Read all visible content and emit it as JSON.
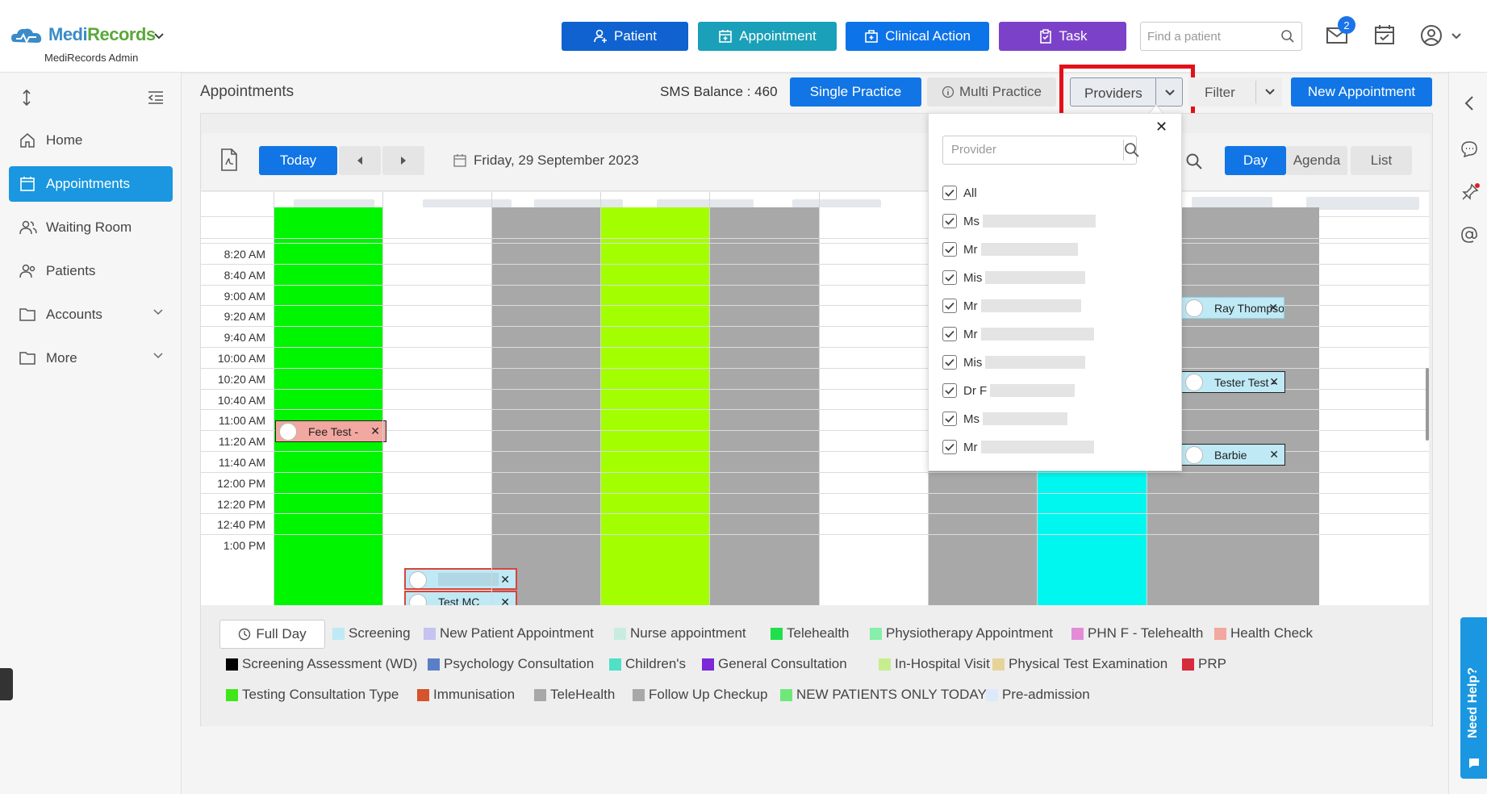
{
  "header": {
    "logo_main": "Medi",
    "logo_accent": "Records",
    "org_label": "MediRecords Admin",
    "buttons": [
      {
        "label": "Patient",
        "color": "#0f62cf"
      },
      {
        "label": "Appointment",
        "color": "#1aa0b8"
      },
      {
        "label": "Clinical Action",
        "color": "#0d73e8"
      },
      {
        "label": "Task",
        "color": "#7b42c9"
      }
    ],
    "search_placeholder": "Find a patient",
    "mail_badge": "2"
  },
  "sidebar": {
    "items": [
      {
        "label": "Home",
        "icon": "home-icon"
      },
      {
        "label": "Appointments",
        "icon": "calendar-icon",
        "active": true
      },
      {
        "label": "Waiting Room",
        "icon": "users-icon"
      },
      {
        "label": "Patients",
        "icon": "patients-icon"
      },
      {
        "label": "Accounts",
        "icon": "folder-icon",
        "expandable": true
      },
      {
        "label": "More",
        "icon": "folder-icon",
        "expandable": true
      }
    ]
  },
  "subheader": {
    "title": "Appointments",
    "sms_balance": "SMS Balance : 460",
    "single_practice": "Single Practice",
    "multi_practice": "Multi Practice",
    "providers": "Providers",
    "filter": "Filter",
    "new_appointment": "New Appointment"
  },
  "calendar": {
    "today": "Today",
    "date": "Friday, 29 September 2023",
    "views": [
      "Day",
      "Agenda",
      "List"
    ],
    "active_view": "Day",
    "times": [
      "8:20 AM",
      "8:40 AM",
      "9:00 AM",
      "9:20 AM",
      "9:40 AM",
      "10:00 AM",
      "10:20 AM",
      "10:40 AM",
      "11:00 AM",
      "11:20 AM",
      "11:40 AM",
      "12:00 PM",
      "12:20 PM",
      "12:40 PM",
      "1:00 PM"
    ],
    "column_colors": [
      "#00f500",
      "#ffffff",
      "#a8a8a8",
      "#a3ff00",
      "#a8a8a8",
      "#ffffff",
      "#a8a8a8",
      "#00f7f0",
      "#a8a8a8"
    ],
    "appointments": [
      {
        "label": "Fee Test -",
        "color": "#f2a7a0"
      },
      {
        "label": "Ray Thompson",
        "color": "#bfe9f5"
      },
      {
        "label": "Tester Test -",
        "color": "#bfe9f5"
      },
      {
        "label": "Barbie",
        "color": "#bfe9f5"
      },
      {
        "label": "Test MC",
        "color": "#bfe9f5"
      }
    ]
  },
  "providers_panel": {
    "search_placeholder": "Provider",
    "items": [
      "All",
      "Ms",
      "Mr",
      "Mis",
      "Mr",
      "Mr",
      "Mis",
      "Dr F",
      "Ms",
      "Mr"
    ]
  },
  "legend": {
    "full_day": "Full Day",
    "items": [
      {
        "label": "Screening",
        "color": "#bfe9f5"
      },
      {
        "label": "New Patient Appointment",
        "color": "#c5c3f0"
      },
      {
        "label": "Nurse appointment",
        "color": "#c9ece0"
      },
      {
        "label": "Telehealth",
        "color": "#1fe04a"
      },
      {
        "label": "Physiotherapy Appointment",
        "color": "#86efaa"
      },
      {
        "label": "PHN F - Telehealth",
        "color": "#e48bd8"
      },
      {
        "label": "Health Check",
        "color": "#f2a7a0"
      },
      {
        "label": "Screening Assessment (WD)",
        "color": "#000000"
      },
      {
        "label": "Psychology Consultation",
        "color": "#5a7fc7"
      },
      {
        "label": "Children's",
        "color": "#4fe0c8"
      },
      {
        "label": "General Consultation",
        "color": "#7a28d8"
      },
      {
        "label": "In-Hospital Visit",
        "color": "#c6ee8f"
      },
      {
        "label": "Physical Test Examination",
        "color": "#e6d39a"
      },
      {
        "label": "PRP",
        "color": "#d62b3b"
      },
      {
        "label": "Testing Consultation Type",
        "color": "#3ee61a"
      },
      {
        "label": "Immunisation",
        "color": "#d5542b"
      },
      {
        "label": "TeleHealth",
        "color": "#a8a8a8"
      },
      {
        "label": "Follow Up Checkup",
        "color": "#a8a8a8"
      },
      {
        "label": "NEW PATIENTS ONLY TODAY",
        "color": "#6ee879"
      },
      {
        "label": "Pre-admission",
        "color": "#dde9fb"
      }
    ]
  },
  "help": {
    "label": "Need Help?"
  }
}
